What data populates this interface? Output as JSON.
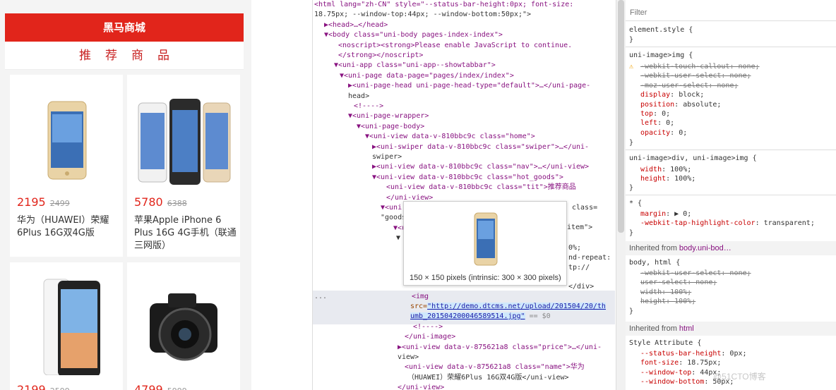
{
  "app": {
    "header_title": "黑马商城",
    "section_title": "推荐商品",
    "goods": [
      {
        "price": "2195",
        "old_price": "2499",
        "name": "华为（HUAWEI）荣耀6Plus 16G双4G版",
        "image": "phone-gold"
      },
      {
        "price": "5780",
        "old_price": "6388",
        "name": "苹果Apple iPhone 6 Plus 16G 4G手机（联通三网版）",
        "image": "iphones"
      },
      {
        "price": "2199",
        "old_price": "2599",
        "name": "",
        "image": "phone-white"
      },
      {
        "price": "4799",
        "old_price": "5999",
        "name": "",
        "image": "camera"
      }
    ]
  },
  "elements": {
    "lines": [
      "<html lang=\"zh-CN\" style=\"--status-bar-height:0px; font-size:",
      "18.75px; --window-top:44px; --window-bottom:50px;\">",
      "▶<head>…</head>",
      "▼<body class=\"uni-body pages-index-index\">",
      "<noscript><strong>Please enable JavaScript to continue.",
      "</strong></noscript>",
      "▼<uni-app class=\"uni-app--showtabbar\">",
      "▼<uni-page data-page=\"pages/index/index\">",
      "▶<uni-page-head uni-page-head-type=\"default\">…</uni-page-",
      "head>",
      "<!---->",
      "▼<uni-page-wrapper>",
      "▼<uni-page-body>",
      "▼<uni-view data-v-810bbc9c class=\"home\">",
      "▶<uni-swiper data-v-810bbc9c class=\"swiper\">…</uni-",
      "swiper>",
      "▶<uni-view data-v-810bbc9c class=\"nav\">…</uni-view>",
      "▼<uni-view data-v-810bbc9c class=\"hot_goods\">",
      "<uni-view data-v-810bbc9c class=\"tit\">推荐商品",
      "</uni-view>",
      "▼<uni",
      "\"goods",
      "▼<ui",
      "▼"
    ],
    "right_fragments": [
      "class=",
      "item\">",
      "0%;",
      "nd-repeat:",
      "tp://",
      "</div>"
    ],
    "selected_line1": "<img",
    "selected_src_label": "src=",
    "selected_src_value": "\"http://demo.dtcms.net/upload/201504/20/th",
    "selected_src_value2": "umb_201504200046589514.jpg\"",
    "selected_suffix": "== $0",
    "after_lines": [
      "<!---->",
      "</uni-image>",
      "▶<uni-view data-v-875621a8 class=\"price\">…</uni-",
      "view>",
      "<uni-view data-v-875621a8 class=\"name\">华为",
      "（HUAWEI）荣耀6Plus 16G双4G版</uni-view>",
      "</uni-view>"
    ],
    "tooltip_caption": "150 × 150 pixels (intrinsic: 300 × 300 pixels)",
    "dots": "..."
  },
  "styles": {
    "filter_placeholder": "Filter",
    "element_style": "element.style {",
    "close": "}",
    "rule1_selector": "uni-image>img {",
    "rule1_props": [
      [
        "-webkit-touch-callout",
        "none",
        true
      ],
      [
        "-webkit-user-select",
        "none",
        true
      ],
      [
        "-moz-user-select",
        "none",
        true
      ],
      [
        "display",
        "block",
        false
      ],
      [
        "position",
        "absolute",
        false
      ],
      [
        "top",
        "0",
        false
      ],
      [
        "left",
        "0",
        false
      ],
      [
        "opacity",
        "0",
        false
      ]
    ],
    "rule2_selector": "uni-image>div, uni-image>img {",
    "rule2_props": [
      [
        "width",
        "100%"
      ],
      [
        "height",
        "100%"
      ]
    ],
    "rule3_selector": "* {",
    "rule3_props": [
      [
        "margin",
        "▶ 0"
      ],
      [
        "-webkit-tap-highlight-color",
        "transparent"
      ]
    ],
    "inherited1_label": "Inherited from ",
    "inherited1_selector": "body.uni-bod…",
    "rule4_selector": "body, html {",
    "rule4_props": [
      [
        "-webkit-user-select",
        "none"
      ],
      [
        "user-select",
        "none"
      ],
      [
        "width",
        "100%"
      ],
      [
        "height",
        "100%"
      ]
    ],
    "inherited2_label": "Inherited from ",
    "inherited2_selector": "html",
    "rule5_selector": "Style Attribute {",
    "rule5_props": [
      [
        "--status-bar-height",
        "0px"
      ],
      [
        "font-size",
        "18.75px"
      ],
      [
        "--window-top",
        "44px"
      ],
      [
        "--window-bottom",
        "50px"
      ]
    ],
    "watermark": "@51CTO博客",
    "colors": {
      "accent": "#e1251b",
      "tag": "#881280",
      "attr": "#994500",
      "value": "#1a1aa6",
      "prop": "#c80000"
    }
  }
}
